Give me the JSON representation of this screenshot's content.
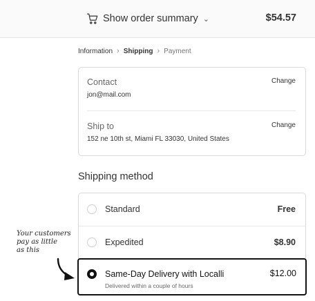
{
  "summary": {
    "toggle_label": "Show order summary",
    "total": "$54.57"
  },
  "breadcrumb": [
    "Information",
    "Shipping",
    "Payment"
  ],
  "contact": {
    "title": "Contact",
    "value": "jon@mail.com",
    "change_label": "Change"
  },
  "ship_to": {
    "title": "Ship to",
    "value": "152 ne 10th st, Miami FL 33030, United States",
    "change_label": "Change"
  },
  "shipping_method": {
    "title": "Shipping method",
    "options": [
      {
        "label": "Standard",
        "price": "Free"
      },
      {
        "label": "Expedited",
        "price": "$8.90"
      }
    ],
    "selected": {
      "label": "Same-Day Delivery with Localli",
      "sub": "Delivered within a couple of hours",
      "price": "$12.00"
    }
  },
  "annotation": {
    "lines": [
      "Your customers",
      "pay as little",
      "as this"
    ]
  },
  "icons": {
    "cart": "cart-icon",
    "chevron": "chevron-down-icon"
  }
}
